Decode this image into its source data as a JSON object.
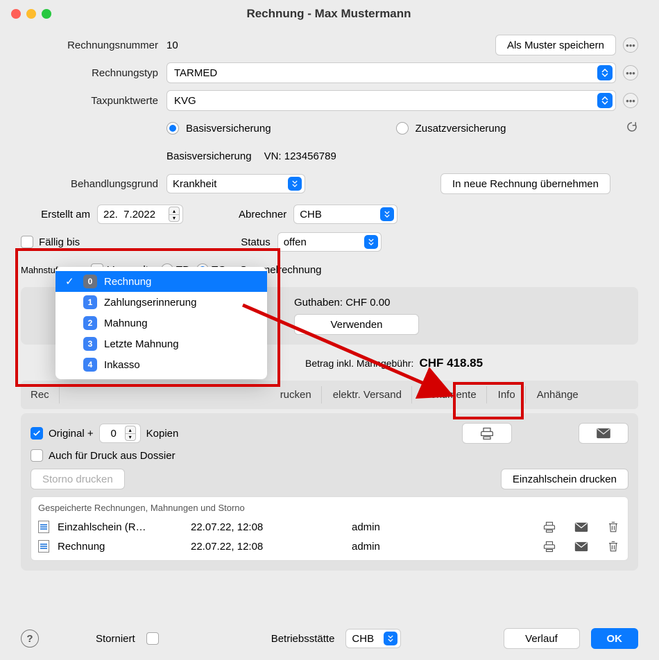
{
  "window": {
    "title": "Rechnung - Max Mustermann"
  },
  "labels": {
    "rechnungsnummer": "Rechnungsnummer",
    "rechnungstyp": "Rechnungstyp",
    "taxpunktwerte": "Taxpunktwerte",
    "behandlungsgrund": "Behandlungsgrund",
    "erstellt_am": "Erstellt am",
    "abrechner": "Abrechner",
    "faellig_bis": "Fällig bis",
    "status": "Status",
    "mahnstufe": "Mahnstufe",
    "versandt": "Versandt",
    "sammelrechnung": "Sammelrechnung",
    "storniert": "Storniert",
    "betriebsstaette": "Betriebsstätte",
    "guthaben": "Guthaben: CHF 0.00",
    "betrag_label": "Betrag inkl. Mahngebühr:",
    "original": "Original +",
    "kopien": "Kopien",
    "auch_dossier": "Auch für Druck aus Dossier",
    "stored_title": "Gespeicherte Rechnungen, Mahnungen und Storno",
    "basis_label_line": "Basisversicherung",
    "vn_line": "VN: 123456789"
  },
  "values": {
    "rechnungsnummer": "10",
    "rechnungstyp": "TARMED",
    "taxpunktwerte": "KVG",
    "behandlungsgrund": "Krankheit",
    "erstellt_am": "22.  7.2022",
    "abrechner": "CHB",
    "status": "offen",
    "kopien": "0",
    "betrag": "CHF 418.85",
    "betriebsstaette": "CHB"
  },
  "radios": {
    "basisversicherung": "Basisversicherung",
    "zusatzversicherung": "Zusatzversicherung",
    "tp": "TP",
    "tg": "TG"
  },
  "buttons": {
    "als_muster": "Als Muster speichern",
    "in_neue": "In neue Rechnung übernehmen",
    "verwenden": "Verwenden",
    "storno_drucken": "Storno drucken",
    "einzahlschein_drucken": "Einzahlschein drucken",
    "verlauf": "Verlauf",
    "ok": "OK"
  },
  "tabs": [
    "Rec",
    "rucken",
    "elektr. Versand",
    "Dokumente",
    "Info",
    "Anhänge"
  ],
  "dropdown": {
    "items": [
      {
        "n": "0",
        "label": "Rechnung",
        "selected": true
      },
      {
        "n": "1",
        "label": "Zahlungserinnerung",
        "selected": false
      },
      {
        "n": "2",
        "label": "Mahnung",
        "selected": false
      },
      {
        "n": "3",
        "label": "Letzte Mahnung",
        "selected": false
      },
      {
        "n": "4",
        "label": "Inkasso",
        "selected": false
      }
    ]
  },
  "stored": [
    {
      "name": "Einzahlschein (R…",
      "date": "22.07.22, 12:08",
      "user": "admin"
    },
    {
      "name": "Rechnung",
      "date": "22.07.22, 12:08",
      "user": "admin"
    }
  ]
}
